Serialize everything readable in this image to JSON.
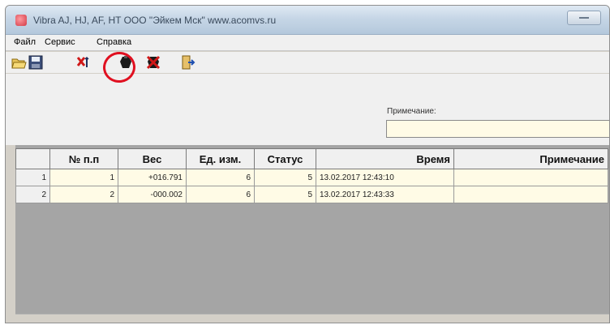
{
  "window": {
    "title": "Vibra AJ, HJ, AF, HT    ООО \"Эйкем Мск\"  www.acomvs.ru"
  },
  "menu": {
    "items": [
      "Файл",
      "Сервис",
      "Справка"
    ]
  },
  "toolbar": {
    "buttons": [
      "open-icon",
      "save-icon",
      "delete-icon",
      "record-icon",
      "stop-record-icon",
      "exit-icon"
    ]
  },
  "note": {
    "label": "Примечание:",
    "value": ""
  },
  "table": {
    "headers": [
      "",
      "№ п.п",
      "Вес",
      "Ед. изм.",
      "Статус",
      "Время",
      "Примечание"
    ],
    "rows": [
      [
        "1",
        "1",
        "+016.791",
        "6",
        "5",
        "13.02.2017 12:43:10",
        ""
      ],
      [
        "2",
        "2",
        "-000.002",
        "6",
        "5",
        "13.02.2017 12:43:33",
        ""
      ]
    ]
  },
  "colors": {
    "highlight": "#e01020",
    "cell_bg": "#fffbe6",
    "grid_bg": "#a5a5a5"
  }
}
